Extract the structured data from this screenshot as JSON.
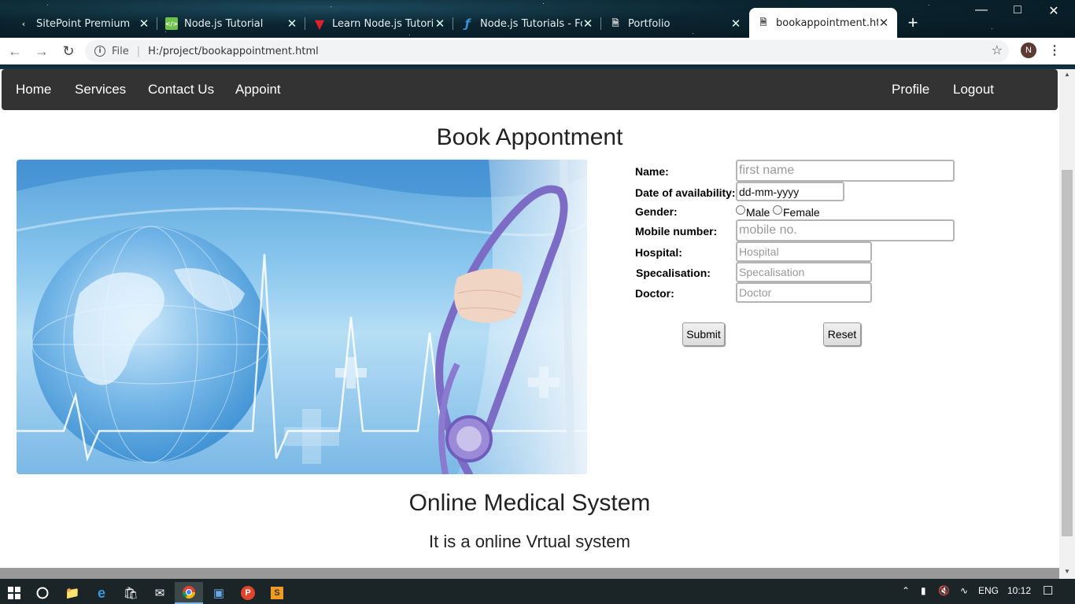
{
  "browser": {
    "tabs": [
      {
        "title": "SitePoint Premium",
        "icon": "sitepoint-icon"
      },
      {
        "title": "Node.js Tutorial",
        "icon": "nodejs-icon"
      },
      {
        "title": "Learn Node.js Tutorial",
        "icon": "tutorial-icon"
      },
      {
        "title": "Node.js Tutorials - For",
        "icon": "tutorials-icon"
      },
      {
        "title": "Portfolio",
        "icon": "document-icon"
      },
      {
        "title": "bookappointment.html",
        "icon": "document-icon"
      }
    ],
    "url_scheme": "File",
    "url": "H:/project/bookappointment.html",
    "profile_initial": "N"
  },
  "nav": {
    "left": [
      "Home",
      "Services",
      "Contact Us",
      "Appoint"
    ],
    "profile": "Profile",
    "logout": "Logout"
  },
  "page": {
    "title": "Book Appontment"
  },
  "form": {
    "name_label": "Name:",
    "name_placeholder": "first name",
    "date_label": "Date of availability:",
    "date_value": "dd-mm-yyyy",
    "gender_label": "Gender:",
    "gender_male": "Male",
    "gender_female": "Female",
    "mobile_label": "Mobile number:",
    "mobile_placeholder": "mobile no.",
    "hospital_label": "Hospital:",
    "hospital_placeholder": "Hospital",
    "specialisation_label": "Specalisation:",
    "specialisation_placeholder": "Specalisation",
    "doctor_label": "Doctor:",
    "doctor_placeholder": "Doctor",
    "submit": "Submit",
    "reset": "Reset"
  },
  "footer": {
    "title": "Online Medical System",
    "subtitle": "It is a online Vrtual system"
  },
  "taskbar": {
    "language": "ENG",
    "time": "10:12"
  },
  "colors": {
    "navbar": "#333333",
    "hero_blue": "#5aa5dc"
  }
}
